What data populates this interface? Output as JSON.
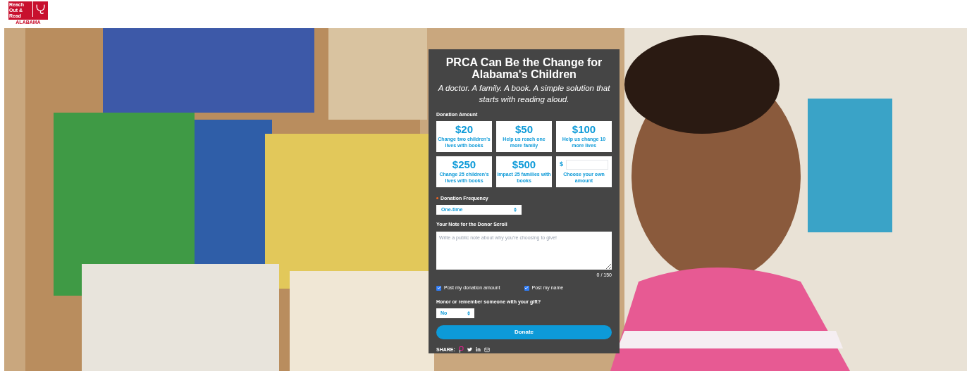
{
  "logo": {
    "name": "Reach Out & Read",
    "region": "ALABAMA"
  },
  "form": {
    "title": "PRCA Can Be the Change for Alabama's Children",
    "subtitle": "A doctor. A family. A book. A simple solution that starts with reading aloud.",
    "amount_label": "Donation Amount",
    "amounts": [
      {
        "kind": "preset",
        "amount": "$20",
        "description": "Change two children's lives with books",
        "selected": false
      },
      {
        "kind": "preset",
        "amount": "$50",
        "description": "Help us reach one more family",
        "selected": false
      },
      {
        "kind": "preset",
        "amount": "$100",
        "description": "Help us change 10 more lives",
        "selected": false
      },
      {
        "kind": "preset",
        "amount": "$250",
        "description": "Change 25 children's lives with books",
        "selected": false
      },
      {
        "kind": "preset",
        "amount": "$500",
        "description": "Impact 25 families with books",
        "selected": false
      },
      {
        "kind": "custom",
        "amount": "$",
        "description": "Choose your own amount",
        "selected": false
      }
    ],
    "frequency": {
      "label": "Donation Frequency",
      "required": true,
      "value": "One-time"
    },
    "note": {
      "label": "Your Note for the Donor Scroll",
      "placeholder": "Write a public note about why you're choosing to give!",
      "counter": "0 / 150"
    },
    "checkboxes": [
      {
        "label": "Post my donation amount",
        "checked": true
      },
      {
        "label": "Post my name",
        "checked": true
      }
    ],
    "honor": {
      "label": "Honor or remember someone with your gift?",
      "value": "No"
    },
    "donate_button": "Donate",
    "share_label": "SHARE:"
  }
}
